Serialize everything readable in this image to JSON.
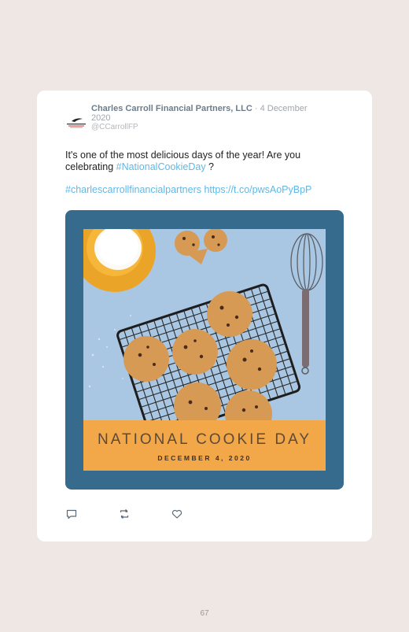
{
  "tweet": {
    "author_name": "Charles Carroll Financial Partners, LLC",
    "date": " · 4 December 2020",
    "handle": "@CCarrollFP",
    "text_before": "It's one of the most delicious days of the year! Are you celebrating ",
    "hashtag": "#NationalCookieDay",
    "text_after": " ?",
    "tag2": "#charlescarrollfinancialpartners",
    "url": "https://t.co/pwsAoPyBpP"
  },
  "image": {
    "headline": "NATIONAL COOKIE DAY",
    "subline": "DECEMBER 4, 2020"
  },
  "actions": {
    "icons": [
      "reply-icon",
      "retweet-icon",
      "like-icon"
    ]
  },
  "page": {
    "number": "67"
  },
  "colors": {
    "page_bg": "#efe7e4",
    "link": "#5fb8e6",
    "frame": "#376b8e",
    "banner": "#f2a848"
  }
}
